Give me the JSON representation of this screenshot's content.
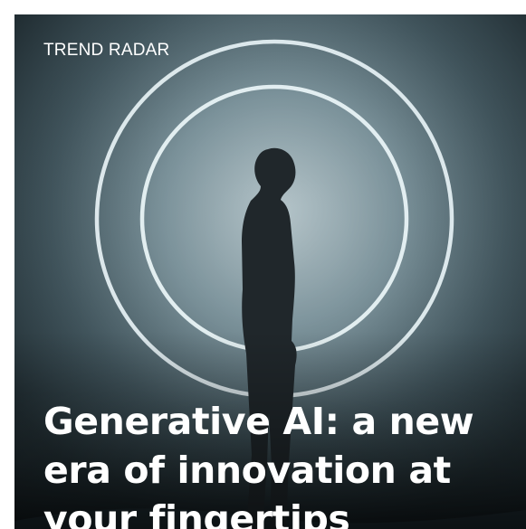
{
  "card": {
    "eyebrow": "TREND RADAR",
    "headline_lines": [
      "Generative AI: a new",
      "era of innovation at",
      "your fingertips"
    ]
  }
}
